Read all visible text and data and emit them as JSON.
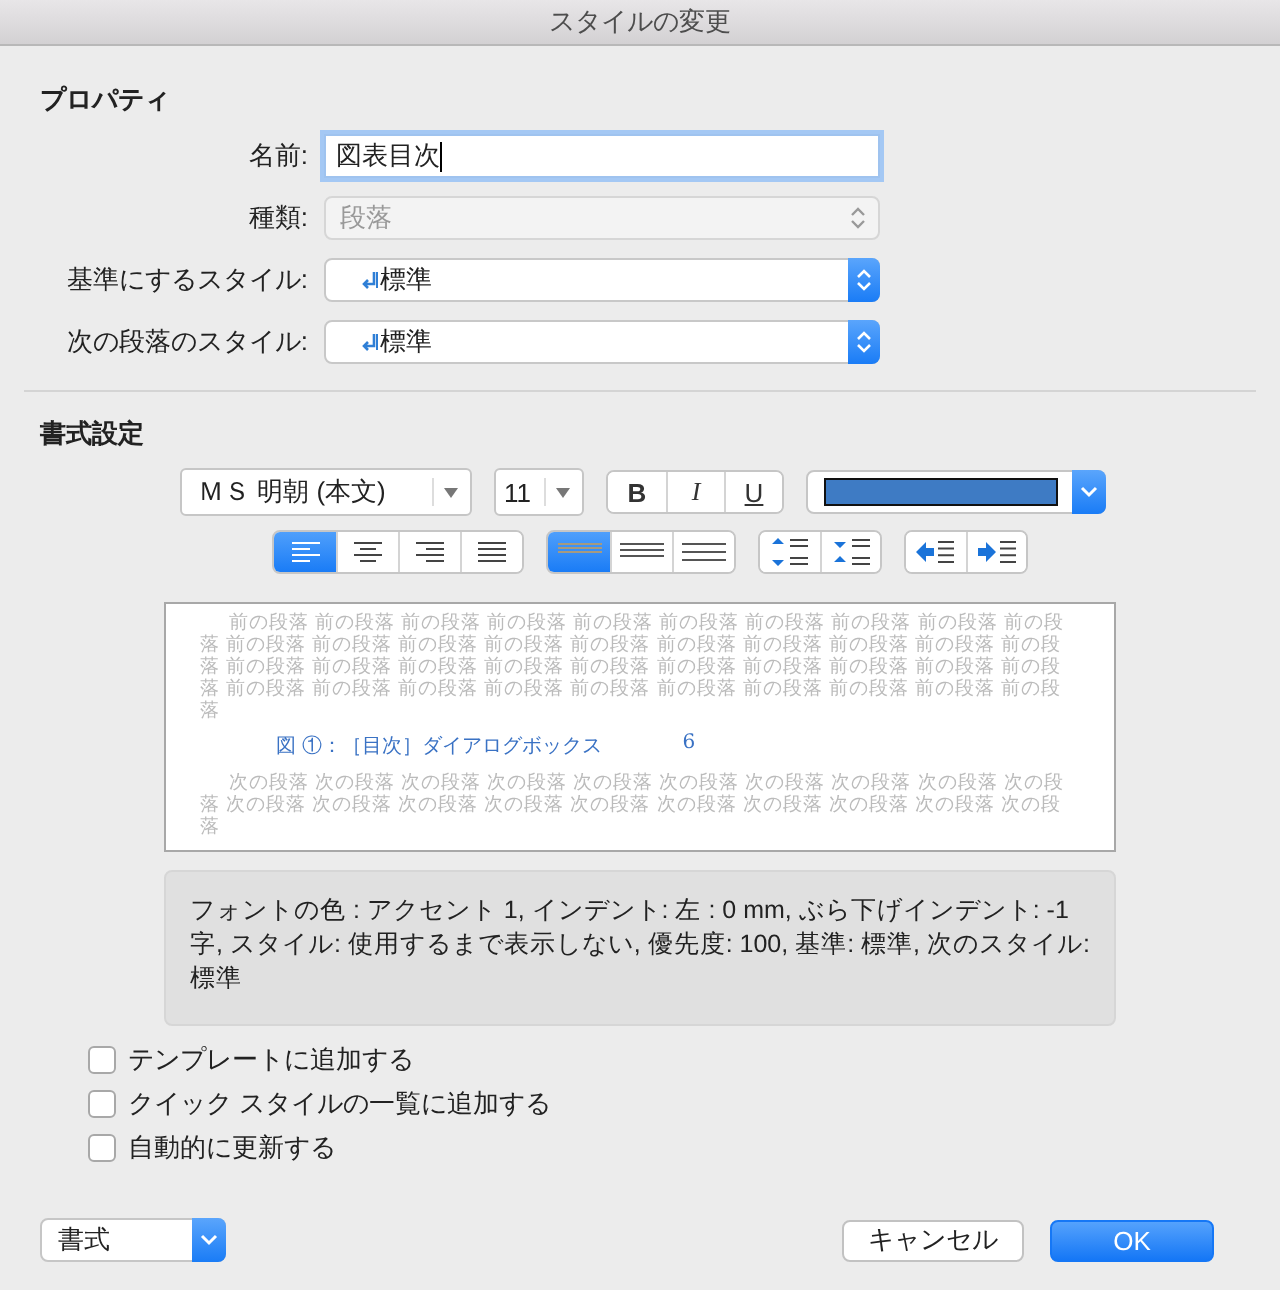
{
  "window": {
    "title": "スタイルの変更"
  },
  "properties": {
    "heading": "プロパティ",
    "fields": [
      {
        "kind": "text",
        "label": "名前:",
        "value": "図表目次",
        "disabled": false
      },
      {
        "kind": "select",
        "label": "種類:",
        "value": "段落",
        "disabled": true
      },
      {
        "kind": "style",
        "label": "基準にするスタイル:",
        "value": "標準",
        "disabled": false
      },
      {
        "kind": "style",
        "label": "次の段落のスタイル:",
        "value": "標準",
        "disabled": false
      }
    ]
  },
  "formatting": {
    "heading": "書式設定",
    "font": "ＭＳ 明朝 (本文)",
    "size": "11",
    "styles": [
      {
        "kind": "bold",
        "label": "B",
        "selected": false
      },
      {
        "kind": "italic",
        "label": "I",
        "selected": false
      },
      {
        "kind": "underline",
        "label": "U",
        "selected": false
      }
    ],
    "font_color": {
      "color": "#3e7bc4"
    },
    "alignment": [
      {
        "kind": "left",
        "selected": true
      },
      {
        "kind": "center",
        "selected": false
      },
      {
        "kind": "right",
        "selected": false
      },
      {
        "kind": "justify",
        "selected": false
      }
    ],
    "line_spacing": [
      {
        "kind": "single",
        "selected": true
      },
      {
        "kind": "onehalf",
        "selected": false
      },
      {
        "kind": "double",
        "selected": false
      }
    ],
    "paragraph_spacing": [
      {
        "kind": "increase",
        "selected": false
      },
      {
        "kind": "decrease",
        "selected": false
      }
    ],
    "indent": [
      {
        "kind": "outdent",
        "selected": false
      },
      {
        "kind": "indent",
        "selected": false
      }
    ]
  },
  "preview": {
    "previous": "前の段落 前の段落 前の段落 前の段落 前の段落 前の段落 前の段落 前の段落 前の段落 前の段落 前の段落 前の段落 前の段落 前の段落 前の段落 前の段落 前の段落 前の段落 前の段落 前の段落 前の段落 前の段落 前の段落 前の段落 前の段落 前の段落 前の段落 前の段落 前の段落 前の段落 前の段落 前の段落 前の段落 前の段落 前の段落 前の段落 前の段落 前の段落 前の段落 前の段落",
    "sample": "図 ①：［目次］ダイアログボックス",
    "sample_page": "6",
    "next": "次の段落 次の段落 次の段落 次の段落 次の段落 次の段落 次の段落 次の段落 次の段落 次の段落 次の段落 次の段落 次の段落 次の段落 次の段落 次の段落 次の段落 次の段落 次の段落 次の段落"
  },
  "description": "フォントの色 : アクセント 1, インデント: 左 :  0 mm, ぶら下げインデント: -1 字, スタイル: 使用するまで表示しない, 優先度: 100, 基準: 標準, 次のスタイル: 標準",
  "options": [
    {
      "label": "テンプレートに追加する",
      "checked": false
    },
    {
      "label": "クイック スタイルの一覧に追加する",
      "checked": false
    },
    {
      "label": "自動的に更新する",
      "checked": false
    }
  ],
  "footer": {
    "format_menu": "書式",
    "cancel": "キャンセル",
    "ok": "OK"
  }
}
